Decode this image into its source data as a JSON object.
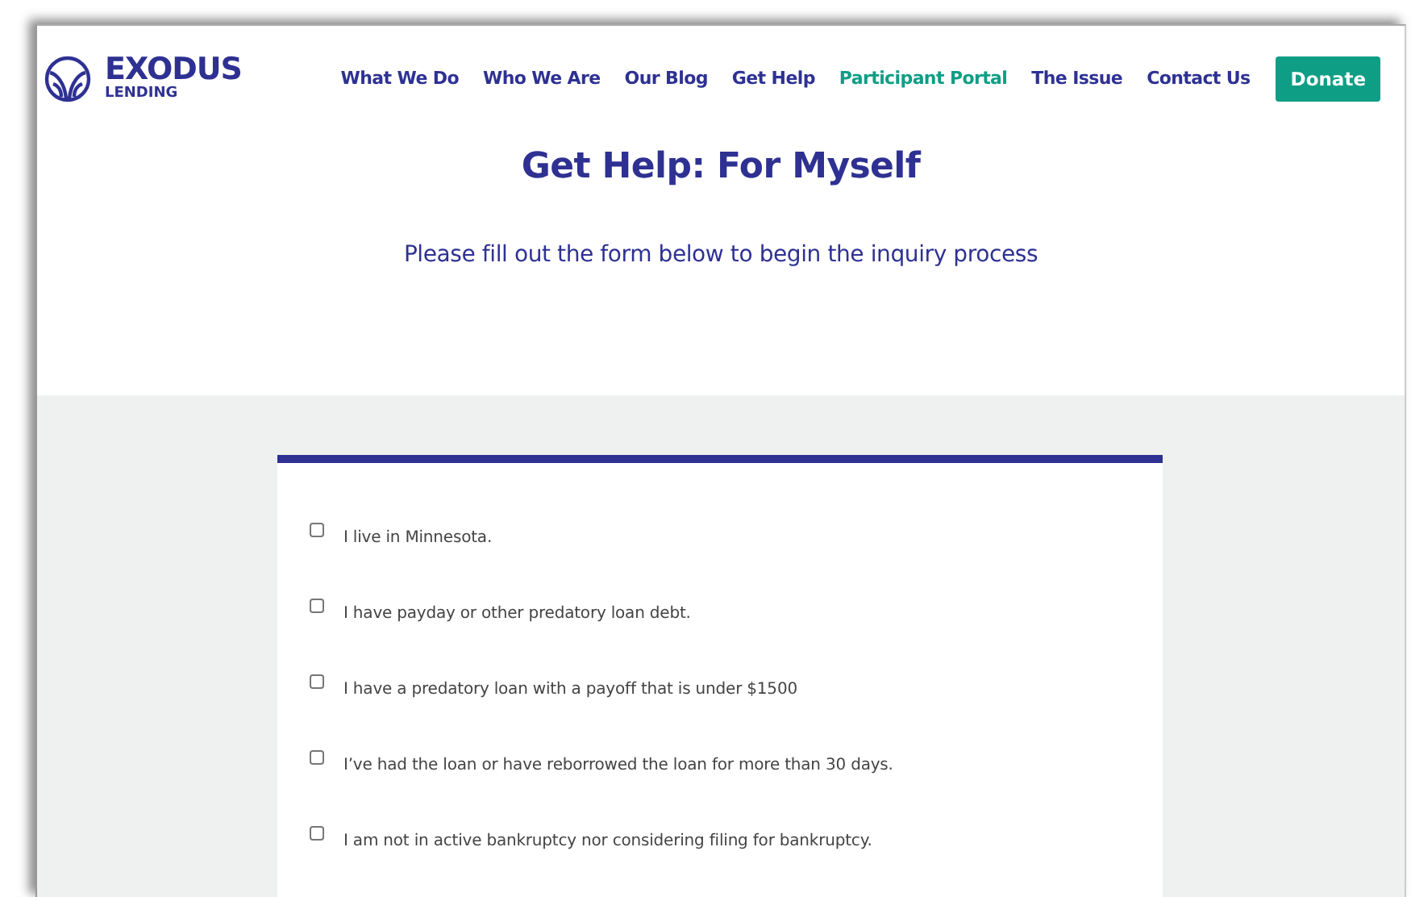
{
  "logo": {
    "name": "EXODUS",
    "tagline": "LENDING"
  },
  "nav": [
    {
      "label": "What We Do",
      "selected": false
    },
    {
      "label": "Who We Are",
      "selected": false
    },
    {
      "label": "Our Blog",
      "selected": false
    },
    {
      "label": "Get Help",
      "selected": false
    },
    {
      "label": "Participant Portal",
      "selected": true
    },
    {
      "label": "The Issue",
      "selected": false
    },
    {
      "label": "Contact Us",
      "selected": false
    }
  ],
  "donate_button": "Donate",
  "heading": "Get Help: For Myself",
  "subtitle": "Please fill out the form below to begin the inquiry process",
  "form": {
    "items": [
      {
        "label": "I live in Minnesota.",
        "checked": false
      },
      {
        "label": "I have payday or other predatory loan debt.",
        "checked": false
      },
      {
        "label": "I have a predatory loan with a payoff that is under $1500",
        "checked": false
      },
      {
        "label": "I’ve had the loan or have reborrowed the loan for more than 30 days.",
        "checked": false
      },
      {
        "label": "I am not in active bankruptcy nor considering filing for bankruptcy.",
        "checked": false
      }
    ]
  }
}
